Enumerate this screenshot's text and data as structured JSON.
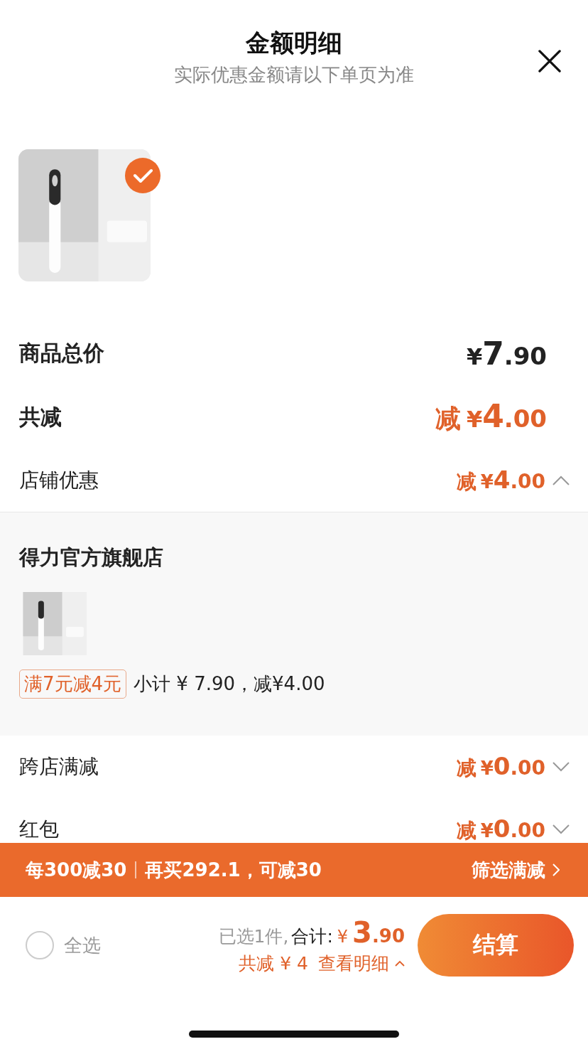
{
  "header": {
    "title": "金额明细",
    "subtitle": "实际优惠金额请以下单页为准"
  },
  "product": {
    "kind": "picture",
    "selected": true
  },
  "summary": [
    {
      "kind": "total",
      "label": "商品总价",
      "currency": "¥",
      "integer": "7",
      "decimal": ".90"
    },
    {
      "kind": "discount",
      "label": "共减",
      "prefix": "减",
      "currency": "¥",
      "integer": "4",
      "decimal": ".00"
    }
  ],
  "discounts": [
    {
      "label": "店铺优惠",
      "prefix": "减",
      "currency": "¥",
      "integer": "4",
      "decimal": ".00",
      "expanded": true,
      "store": {
        "name": "得力官方旗舰店",
        "product": {
          "kind": "picture"
        },
        "tag": "满7元减4元",
        "subtotal": "小计 ¥ 7.90，减¥4.00"
      }
    },
    {
      "label": "跨店满减",
      "prefix": "减",
      "currency": "¥",
      "integer": "0",
      "decimal": ".00",
      "expanded": false
    },
    {
      "label": "红包",
      "prefix": "减",
      "currency": "¥",
      "integer": "0",
      "decimal": ".00",
      "expanded": false
    }
  ],
  "banner": {
    "rule": "每300减30",
    "hint": "再买292.1，可减30",
    "link": "筛选满减"
  },
  "footer": {
    "select_all": {
      "label": "全选",
      "checked": false
    },
    "count": "已选1件,",
    "total_label": "合计:",
    "currency": "¥",
    "integer": "3",
    "decimal": ".90",
    "savings": "共减 ¥ 4",
    "details_link": "查看明细",
    "checkout": "结算"
  }
}
